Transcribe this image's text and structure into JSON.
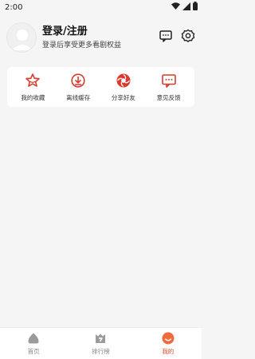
{
  "status_bar": {
    "time": "2:00",
    "icons": [
      "wifi-icon",
      "signal-icon",
      "battery-icon"
    ]
  },
  "header": {
    "icons": [
      "message-icon",
      "settings-icon"
    ]
  },
  "profile": {
    "title": "登录/注册",
    "subtitle": "登录后享受更多看剧权益",
    "avatar_icon": "default-avatar-icon"
  },
  "quick_actions": [
    {
      "label": "我的收藏",
      "icon": "star-icon"
    },
    {
      "label": "离线缓存",
      "icon": "download-icon"
    },
    {
      "label": "分享好友",
      "icon": "share-icon"
    },
    {
      "label": "意见反馈",
      "icon": "feedback-icon"
    }
  ],
  "accent_color": "#d93a2b",
  "bottom_nav": {
    "items": [
      {
        "label": "首页",
        "icon": "home-icon",
        "active": false
      },
      {
        "label": "排行榜",
        "icon": "ranking-icon",
        "active": false
      },
      {
        "label": "我的",
        "icon": "profile-icon",
        "active": true
      }
    ]
  }
}
